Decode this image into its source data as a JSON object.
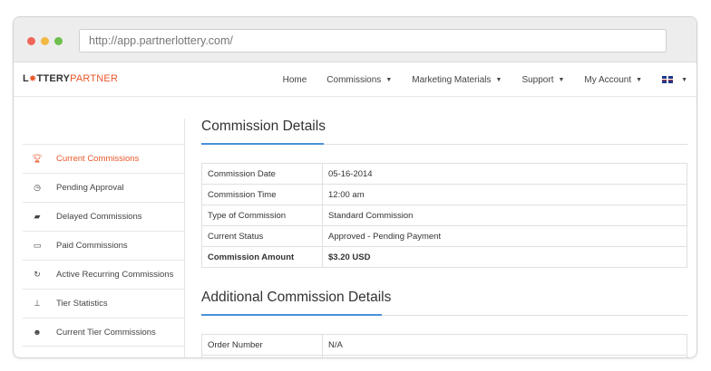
{
  "browser": {
    "url": "http://app.partnerlottery.com/"
  },
  "logo": {
    "l": "L",
    "part1": "TTERY",
    "part2": "PARTNER"
  },
  "nav": {
    "items": [
      {
        "label": "Home",
        "dropdown": false
      },
      {
        "label": "Commissions",
        "dropdown": true
      },
      {
        "label": "Marketing Materials",
        "dropdown": true
      },
      {
        "label": "Support",
        "dropdown": true
      },
      {
        "label": "My Account",
        "dropdown": true
      }
    ],
    "language_icon": "uk-flag-icon"
  },
  "sidebar": {
    "items": [
      {
        "label": "Current Commissions",
        "icon": "trophy-icon",
        "active": true
      },
      {
        "label": "Pending Approval",
        "icon": "clock-icon",
        "active": false
      },
      {
        "label": "Delayed Commissions",
        "icon": "truck-icon",
        "active": false
      },
      {
        "label": "Paid Commissions",
        "icon": "credit-card-icon",
        "active": false
      },
      {
        "label": "Active Recurring Commissions",
        "icon": "refresh-icon",
        "active": false
      },
      {
        "label": "Tier Statistics",
        "icon": "sitemap-icon",
        "active": false
      },
      {
        "label": "Current Tier Commissions",
        "icon": "users-icon",
        "active": false
      }
    ]
  },
  "details": {
    "title": "Commission Details",
    "rows": [
      {
        "label": "Commission Date",
        "value": "05-16-2014"
      },
      {
        "label": "Commission Time",
        "value": "12:00 am"
      },
      {
        "label": "Type of Commission",
        "value": "Standard Commission"
      },
      {
        "label": "Current Status",
        "value": "Approved - Pending Payment"
      }
    ],
    "total": {
      "label": "Commission Amount",
      "value": "$3.20 USD"
    }
  },
  "additional": {
    "title": "Additional Commission Details",
    "rows": [
      {
        "label": "Order Number",
        "value": "N/A"
      }
    ]
  },
  "colors": {
    "accent": "#e8572a",
    "link_rule": "#4a90d9"
  }
}
